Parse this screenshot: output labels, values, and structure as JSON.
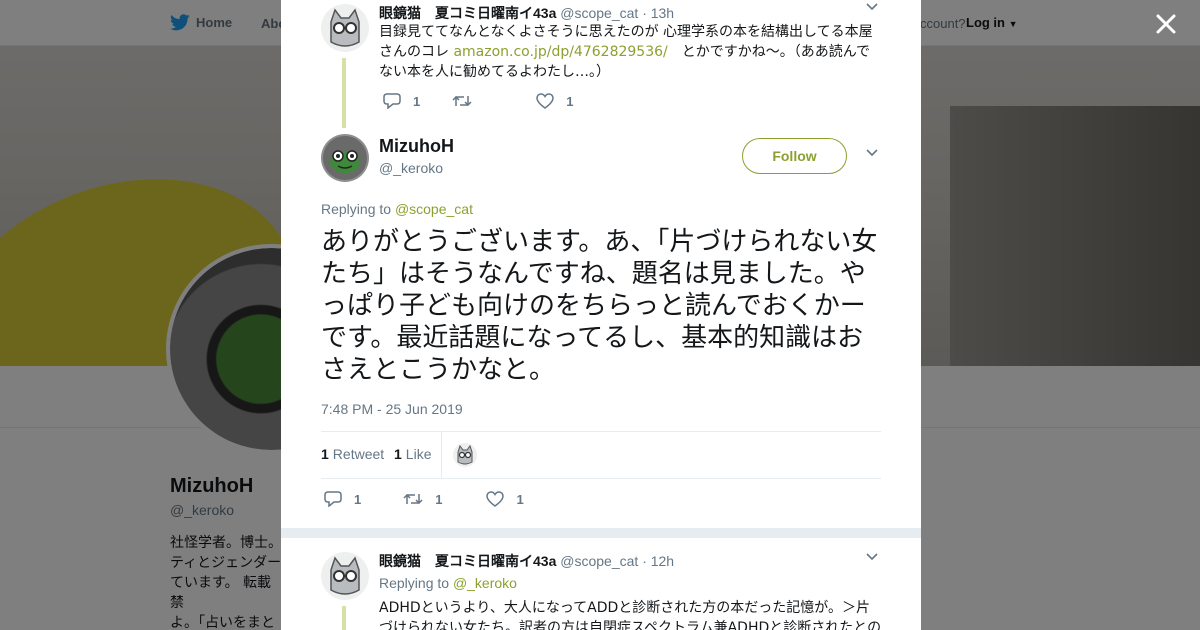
{
  "background_page": {
    "nav": {
      "home_label": "Home",
      "about_label": "Abo",
      "account_label": "ccount?",
      "login_label": "Log in"
    },
    "profile": {
      "name": "MizuhoH",
      "handle": "@_keroko",
      "bio": "社怪学者。博士。\nティとジェンダー\nています。 転載禁\nよ。「占いをまと"
    }
  },
  "modal": {
    "close_icon": "close-icon",
    "context_tweet": {
      "author_name": "眼鏡猫　夏コミ日曜南イ43a",
      "author_handle": "@scope_cat",
      "time": "· 13h",
      "text_before": "目録見ててなんとなくよさそうに思えたのが 心理学系の本を結構出してる本屋さんのコレ ",
      "link": "amazon.co.jp/dp/4762829536/",
      "text_after": "　とかですかね～。（ああ読んでない本を人に勧めてるよわたし…。）",
      "reply_count": "1",
      "retweet_count": "",
      "like_count": "1"
    },
    "main_tweet": {
      "author_name": "MizuhoH",
      "author_handle": "@_keroko",
      "follow_label": "Follow",
      "replying_to_label": "Replying to",
      "replying_to_handle": "@scope_cat",
      "text": "ありがとうございます。あ、「片づけられない女たち」はそうなんですね、題名は見ました。やっぱり子ども向けのをちらっと読んでおくかーです。最近話題になってるし、基本的知識はおさえとこうかなと。",
      "timestamp": "7:48 PM - 25 Jun 2019",
      "retweets_count": "1",
      "retweets_label": "Retweet",
      "likes_count": "1",
      "likes_label": "Like",
      "reply_count": "1",
      "retweet_count": "1",
      "like_count": "1"
    },
    "reply_tweet": {
      "author_name": "眼鏡猫　夏コミ日曜南イ43a",
      "author_handle": "@scope_cat",
      "time": "· 12h",
      "replying_to_label": "Replying to",
      "replying_to_handle": "@_keroko",
      "text": "ADHDというより、大人になってADDと診断された方の本だった記憶が。＞片づけられない女たち。訳者の方は自閉症スペクトラム兼ADHDと診断されたとの"
    }
  },
  "colors": {
    "accent": "#8ba12f",
    "text": "#14171a",
    "muted": "#657786",
    "thread_line": "#d6e0a8"
  }
}
